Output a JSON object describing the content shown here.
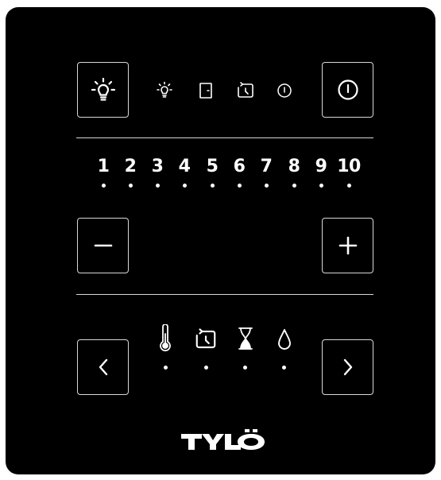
{
  "panel": {
    "background": "#000000",
    "foreground": "#ffffff",
    "border_color": "#d8d8d8"
  },
  "top_row": {
    "light_button": {
      "icon": "light-bulb-icon"
    },
    "status_icons": [
      {
        "name": "light-status-icon"
      },
      {
        "name": "door-icon"
      },
      {
        "name": "timer-icon"
      },
      {
        "name": "standby-icon"
      }
    ],
    "power_button": {
      "icon": "power-icon"
    }
  },
  "levels": [
    "1",
    "2",
    "3",
    "4",
    "5",
    "6",
    "7",
    "8",
    "9",
    "10"
  ],
  "adjust": {
    "minus_icon": "minus-icon",
    "plus_icon": "plus-icon"
  },
  "bottom_row": {
    "prev_icon": "chevron-left-icon",
    "next_icon": "chevron-right-icon",
    "modes": [
      {
        "name": "temperature-icon"
      },
      {
        "name": "timer-icon"
      },
      {
        "name": "hourglass-icon"
      },
      {
        "name": "humidity-drop-icon"
      }
    ]
  },
  "brand": {
    "logo_text": "TYLÖ"
  }
}
